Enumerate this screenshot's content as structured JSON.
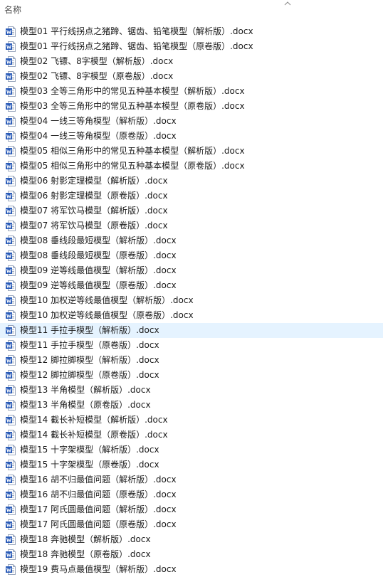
{
  "header": {
    "name_column_label": "名称",
    "sort_icon": "chevron-up-icon"
  },
  "colors": {
    "selected_row": "#e5f3ff",
    "word_icon_blue": "#2b5cb8"
  },
  "file_icon": "word-document-icon",
  "files": [
    "模型01 平行线拐点之猪蹄、锯齿、铅笔模型（解析版）.docx",
    "模型01 平行线拐点之猪蹄、锯齿、铅笔模型（原卷版）.docx",
    "模型02 飞镖、8字模型（解析版）.docx",
    "模型02 飞镖、8字模型（原卷版）.docx",
    "模型03 全等三角形中的常见五种基本模型（解析版）.docx",
    "模型03 全等三角形中的常见五种基本模型（原卷版）.docx",
    "模型04 一线三等角模型（解析版）.docx",
    "模型04 一线三等角模型（原卷版）.docx",
    "模型05 相似三角形中的常见五种基本模型（解析版）.docx",
    "模型05 相似三角形中的常见五种基本模型（原卷版）.docx",
    "模型06 射影定理模型（解析版）.docx",
    "模型06 射影定理模型（原卷版）.docx",
    "模型07 将军饮马模型（解析版）.docx",
    "模型07 将军饮马模型（原卷版）.docx",
    "模型08 垂线段最短模型（解析版）.docx",
    "模型08 垂线段最短模型（原卷版）.docx",
    "模型09 逆等线最值模型（解析版）.docx",
    "模型09 逆等线最值模型（原卷版）.docx",
    "模型10 加权逆等线最值模型（解析版）.docx",
    "模型10 加权逆等线最值模型（原卷版）.docx",
    "模型11 手拉手模型（解析版）.docx",
    "模型11 手拉手模型（原卷版）.docx",
    "模型12 脚拉脚模型（解析版）.docx",
    "模型12 脚拉脚模型（原卷版）.docx",
    "模型13 半角模型（解析版）.docx",
    "模型13 半角模型（原卷版）.docx",
    "模型14 截长补短模型（解析版）.docx",
    "模型14 截长补短模型（原卷版）.docx",
    "模型15 十字架模型（解析版）.docx",
    "模型15 十字架模型（原卷版）.docx",
    "模型16 胡不归最值问题（解析版）.docx",
    "模型16 胡不归最值问题（原卷版）.docx",
    "模型17 阿氏圆最值问题（解析版）.docx",
    "模型17 阿氏圆最值问题（原卷版）.docx",
    "模型18 奔驰模型（解析版）.docx",
    "模型18 奔驰模型（原卷版）.docx",
    "模型19 费马点最值模型（解析版）.docx"
  ],
  "selected_index": 20
}
